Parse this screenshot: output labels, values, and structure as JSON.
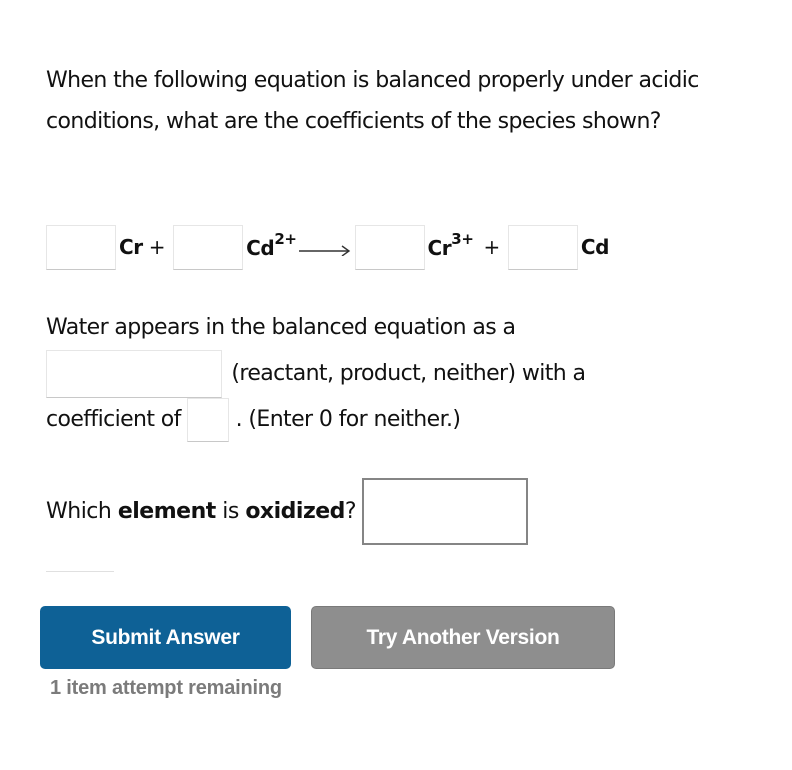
{
  "question": {
    "prompt": "When the following equation is balanced properly under acidic conditions, what are the coefficients of the species shown?"
  },
  "equation": {
    "reactants": [
      {
        "formula": "Cr",
        "charge": "",
        "coefficient_value": ""
      },
      {
        "formula": "Cd",
        "charge": "2+",
        "coefficient_value": ""
      }
    ],
    "products": [
      {
        "formula": "Cr",
        "charge": "3+",
        "coefficient_value": ""
      },
      {
        "formula": "Cd",
        "charge": "",
        "coefficient_value": ""
      }
    ],
    "plus_sign": "+",
    "arrow_icon": "right-arrow"
  },
  "water": {
    "lead_text": "Water appears in the balanced equation as a",
    "role_value": "",
    "options_text": "(reactant, product, neither) with a",
    "coef_label": "coefficient of",
    "coef_value": "",
    "hint_text": ". (Enter 0 for neither.)"
  },
  "oxidized": {
    "prefix": "Which ",
    "bold1": "element",
    "middle": " is ",
    "bold2": "oxidized",
    "suffix": "?",
    "value": ""
  },
  "buttons": {
    "submit_label": "Submit Answer",
    "try_label": "Try Another Version"
  },
  "status": {
    "attempts_text": "1 item attempt remaining"
  },
  "colors": {
    "submit_bg": "#0e6196",
    "try_bg": "#8e8e8e",
    "attempts_text": "#7b7b7b"
  }
}
